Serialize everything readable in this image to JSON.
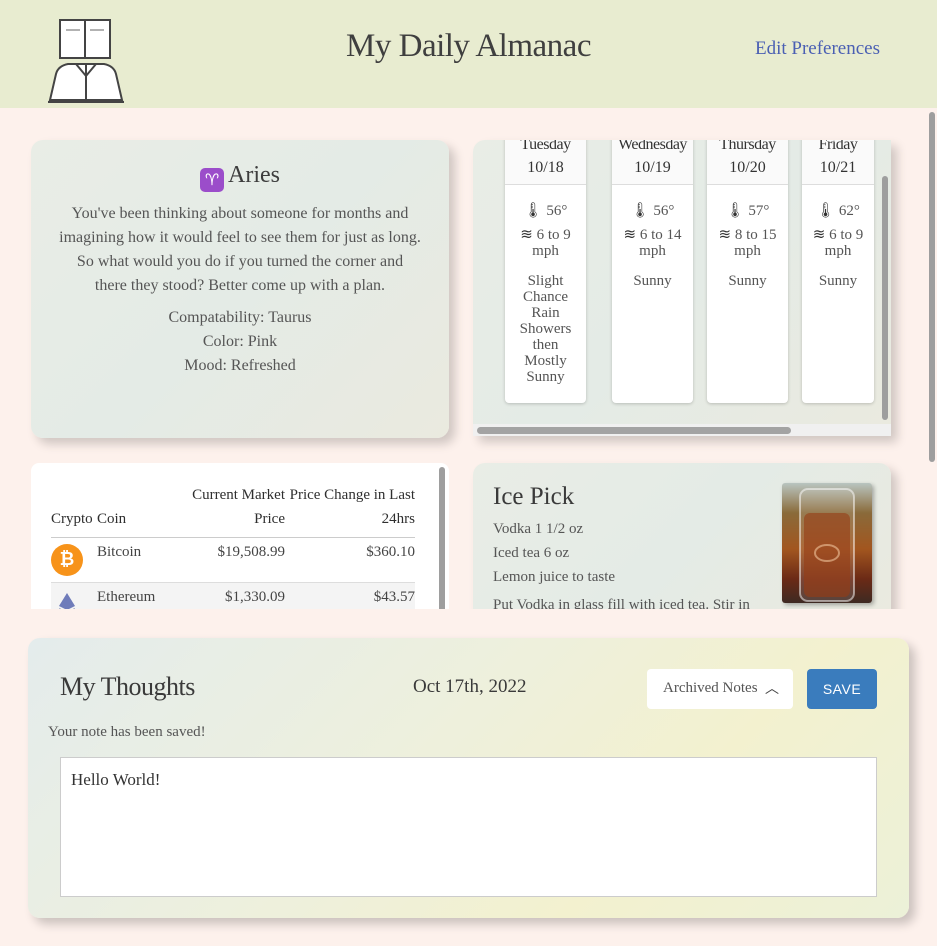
{
  "header": {
    "title": "My Daily Almanac",
    "edit_link": "Edit Preferences",
    "logo_icon": "reader-logo-icon"
  },
  "horoscope": {
    "sign": "Aries",
    "sign_symbol": "♈",
    "reading": "You've been thinking about someone for months and imagining how it would feel to see them for just as long. So what would you do if you turned the corner and there they stood? Better come up with a plan.",
    "compatibility": "Compatability: Taurus",
    "color": "Color: Pink",
    "mood": "Mood: Refreshed"
  },
  "weather": {
    "days": [
      {
        "day": "Tuesday",
        "date": "10/18",
        "temp": "56°",
        "wind": "6 to 9 mph",
        "condition": "Slight Chance Rain Showers then Mostly Sunny"
      },
      {
        "day": "Wednesday",
        "date": "10/19",
        "temp": "56°",
        "wind": "6 to 14 mph",
        "condition": "Sunny"
      },
      {
        "day": "Thursday",
        "date": "10/20",
        "temp": "57°",
        "wind": "8 to 15 mph",
        "condition": "Sunny"
      },
      {
        "day": "Friday",
        "date": "10/21",
        "temp": "62°",
        "wind": "6 to 9 mph",
        "condition": "Sunny"
      }
    ]
  },
  "crypto": {
    "headers": [
      "Crypto",
      "Coin",
      "Current Market Price",
      "Price Change in Last 24hrs"
    ],
    "rows": [
      {
        "coin": "Bitcoin",
        "price": "$19,508.99",
        "change": "$360.10"
      },
      {
        "coin": "Ethereum",
        "price": "$1,330.09",
        "change": "$43.57"
      }
    ]
  },
  "recipe": {
    "title": "Ice Pick",
    "ingredients": [
      "Vodka 1 1/2 oz",
      "Iced tea 6 oz",
      "Lemon juice to taste"
    ],
    "instructions": "Put Vodka in glass fill with iced tea. Stir in"
  },
  "thoughts": {
    "title": "My Thoughts",
    "date": "Oct 17th, 2022",
    "archive_label": "Archived Notes",
    "save_label": "SAVE",
    "saved_message": "Your note has been saved!",
    "note_text": "Hello World!"
  }
}
